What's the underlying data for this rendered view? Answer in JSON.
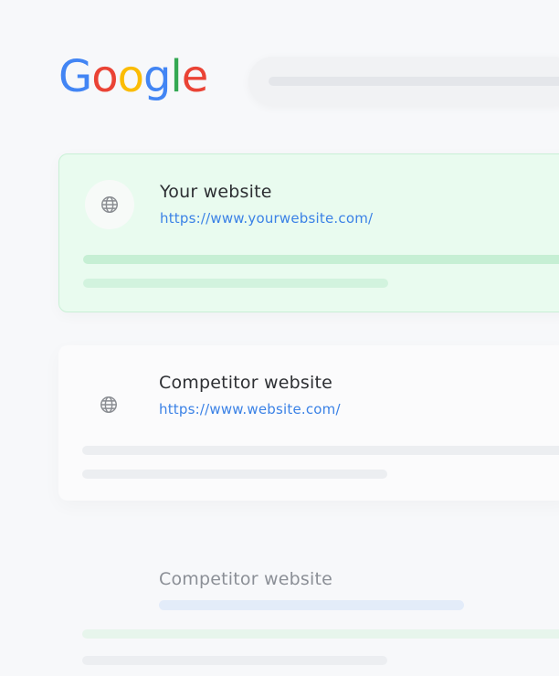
{
  "logo": {
    "letters": [
      "G",
      "o",
      "o",
      "g",
      "l",
      "e"
    ],
    "colors": [
      "#4285F4",
      "#EA4335",
      "#FBBC05",
      "#4285F4",
      "#34A853",
      "#EA4335"
    ]
  },
  "results": [
    {
      "title": "Your website",
      "url": "https://www.yourwebsite.com/",
      "icon": "globe-icon",
      "accent": "#e9fbef"
    },
    {
      "title": "Competitor website",
      "url": "https://www.website.com/",
      "icon": "globe-icon"
    },
    {
      "title": "Competitor website"
    }
  ],
  "colors": {
    "link": "#3b82e6",
    "highlight_background": "#e9fbef",
    "highlight_border": "#c9f0d6"
  }
}
